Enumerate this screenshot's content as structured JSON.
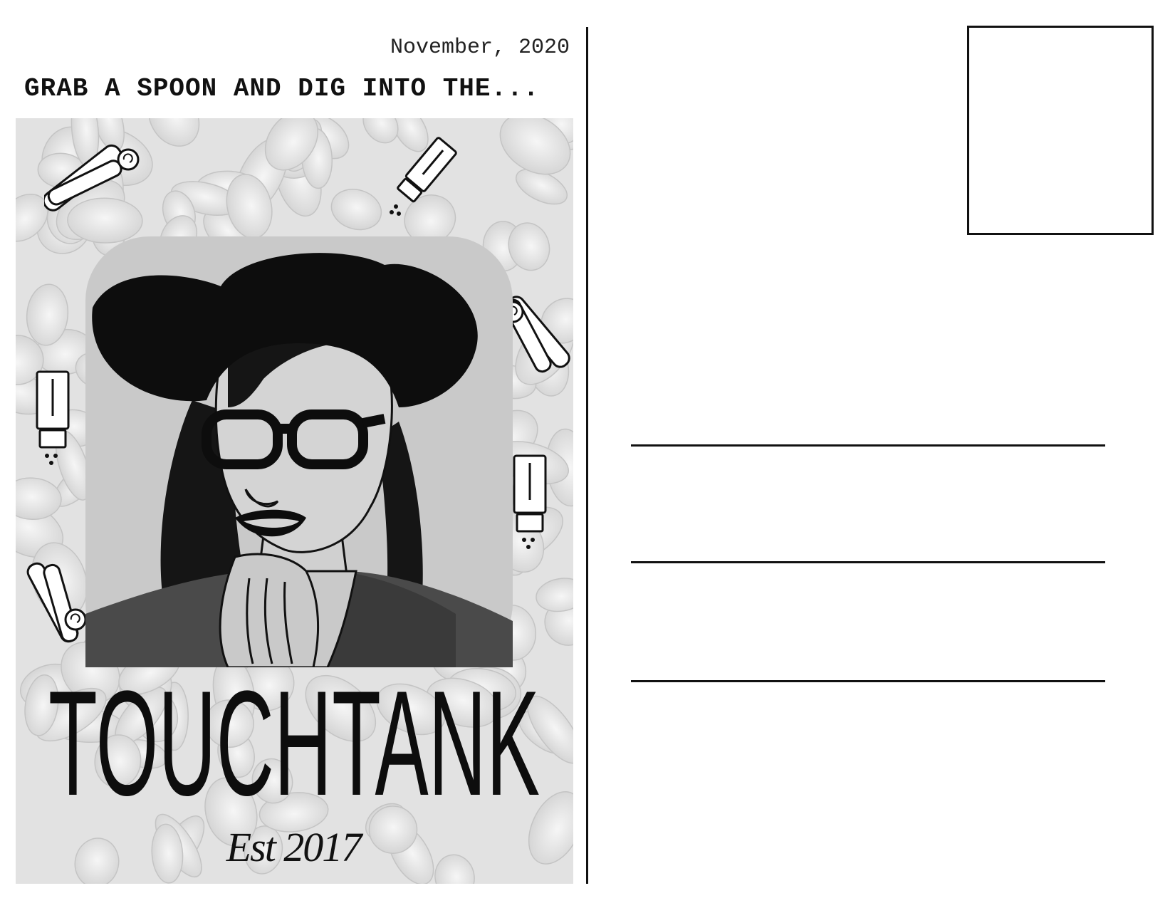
{
  "postcard": {
    "date": "November, 2020",
    "headline": "GRAB A SPOON AND DIG INTO THE...",
    "brand": {
      "name": "TOUCHTANK",
      "established": "Est 2017"
    },
    "illustration": {
      "subject": "cartoon-portrait-with-hat-and-glasses",
      "decorations": [
        "cinnamon-sticks-icon",
        "salt-shaker-icon"
      ]
    },
    "colors": {
      "ink": "#111111",
      "panel_background": "#e3e3e3",
      "portrait_background": "#c9c9c9"
    }
  },
  "address_side": {
    "stamp_box": "empty",
    "address_lines": 3
  }
}
